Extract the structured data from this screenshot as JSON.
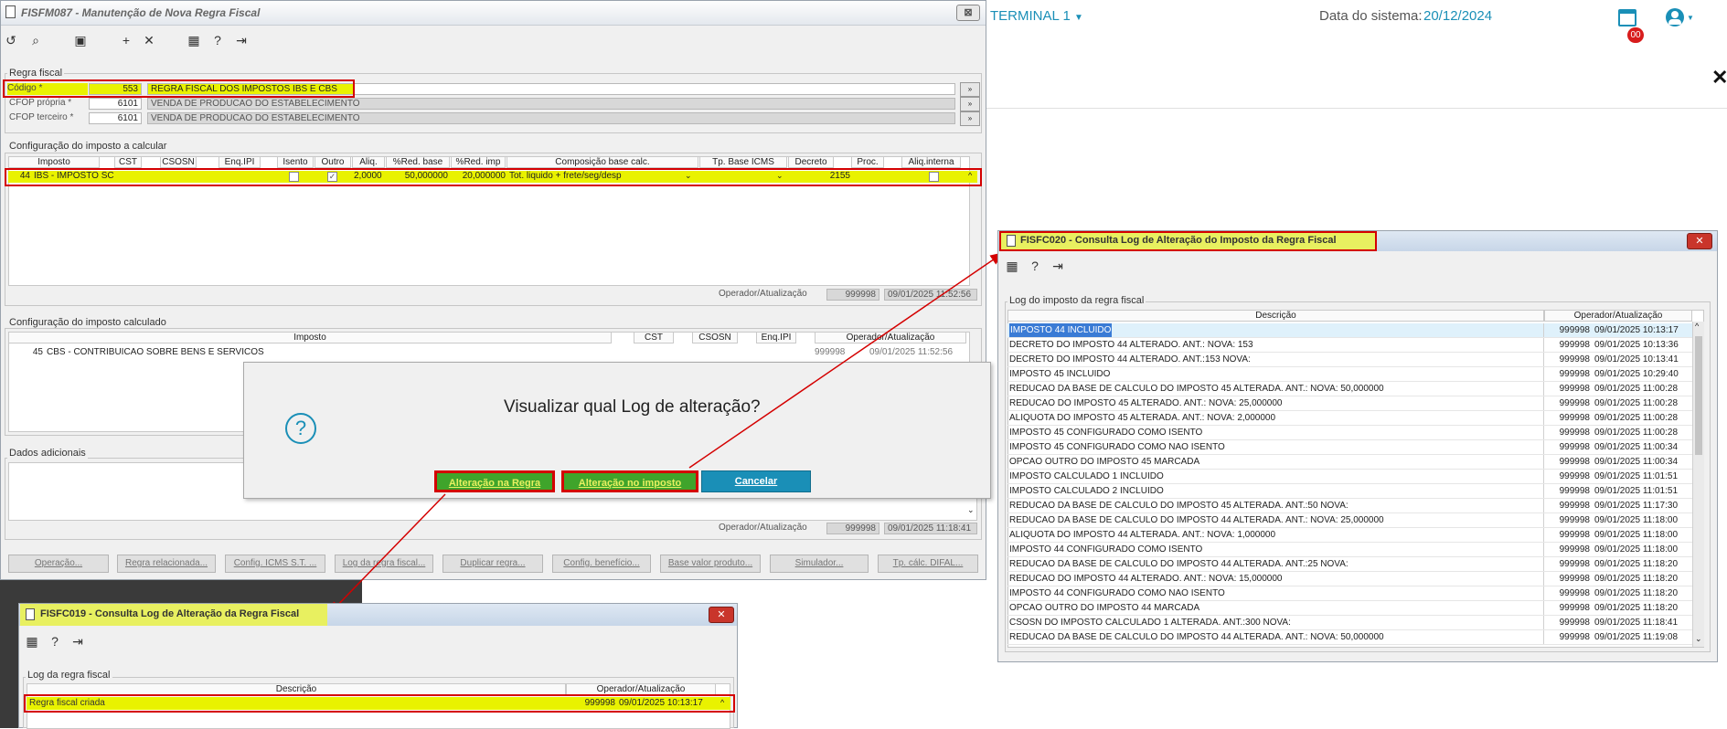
{
  "topbar": {
    "terminal": "TERMINAL 1",
    "date_label": "Data do sistema:",
    "date_value": "20/12/2024",
    "notif_count": "00",
    "close_glyph": "✕"
  },
  "main_window": {
    "title": "FISFM087 - Manutenção de Nova Regra Fiscal",
    "close_glyph": "⊠",
    "regra_fiscal": {
      "group_label": "Regra fiscal",
      "rows": [
        {
          "label": "Código *",
          "code": "553",
          "desc": "REGRA FISCAL DOS IMPOSTOS IBS E CBS"
        },
        {
          "label": "CFOP própria *",
          "code": "6101",
          "desc": "VENDA DE PRODUCAO DO ESTABELECIMENTO"
        },
        {
          "label": "CFOP terceiro *",
          "code": "6101",
          "desc": "VENDA DE PRODUCAO DO ESTABELECIMENTO"
        }
      ]
    },
    "config_calcular": {
      "group_label": "Configuração do imposto a calcular",
      "headers": [
        "Imposto",
        "CST",
        "CSOSN",
        "Enq.IPI",
        "Isento",
        "Outro",
        "Aliq.",
        "%Red. base",
        "%Red. imp",
        "Composição base calc.",
        "Tp. Base ICMS",
        "Decreto",
        "Proc.",
        "Aliq.interna"
      ],
      "row": {
        "code": "44",
        "imposto": "IBS - IMPOSTO SC",
        "aliq": "2,0000",
        "red_base": "50,000000",
        "red_imp": "20,000000",
        "composicao": "Tot. liquido + frete/seg/desp",
        "decreto": "2155"
      },
      "operador_label": "Operador/Atualização",
      "operador": "999998",
      "atualizacao": "09/01/2025 11:52:56"
    },
    "config_calculado": {
      "group_label": "Configuração do imposto calculado",
      "headers": [
        "Imposto",
        "CST",
        "CSOSN",
        "Enq.IPI",
        "Operador/Atualização"
      ],
      "row": {
        "code": "45",
        "imposto": "CBS - CONTRIBUICAO SOBRE BENS E SERVICOS",
        "operador": "999998",
        "atualizacao": "09/01/2025 11:52:56"
      }
    },
    "dados_adicionais": {
      "group_label": "Dados adicionais",
      "operador_label": "Operador/Atualização",
      "operador": "999998",
      "atualizacao": "09/01/2025 11:18:41"
    },
    "bottom_buttons": [
      "Operação...",
      "Regra relacionada...",
      "Config. ICMS S.T. ...",
      "Log da regra fiscal...",
      "Duplicar regra...",
      "Config. benefício...",
      "Base valor produto...",
      "Simulador...",
      "Tp. cálc. DIFAL..."
    ]
  },
  "dialog": {
    "question": "Visualizar qual Log de alteração?",
    "btn_regra": "Alteração na Regra",
    "btn_imposto": "Alteração no imposto",
    "btn_cancel": "Cancelar"
  },
  "win_c020": {
    "title": "FISFC020 - Consulta Log de Alteração do Imposto da Regra Fiscal",
    "group_label": "Log do imposto da regra fiscal",
    "col_desc": "Descrição",
    "col_op": "Operador/Atualização",
    "rows": [
      {
        "d": "IMPOSTO 44 INCLUIDO",
        "o": "999998",
        "t": "09/01/2025 10:13:17"
      },
      {
        "d": "DECRETO DO IMPOSTO 44 ALTERADO. ANT.: NOVA: 153",
        "o": "999998",
        "t": "09/01/2025 10:13:36"
      },
      {
        "d": "DECRETO DO IMPOSTO 44 ALTERADO. ANT.:153 NOVA:",
        "o": "999998",
        "t": "09/01/2025 10:13:41"
      },
      {
        "d": "IMPOSTO 45 INCLUIDO",
        "o": "999998",
        "t": "09/01/2025 10:29:40"
      },
      {
        "d": "REDUCAO DA BASE DE CALCULO DO IMPOSTO 45 ALTERADA. ANT.: NOVA: 50,000000",
        "o": "999998",
        "t": "09/01/2025 11:00:28"
      },
      {
        "d": "REDUCAO DO IMPOSTO 45 ALTERADO. ANT.: NOVA: 25,000000",
        "o": "999998",
        "t": "09/01/2025 11:00:28"
      },
      {
        "d": "ALIQUOTA DO IMPOSTO 45 ALTERADA. ANT.: NOVA: 2,000000",
        "o": "999998",
        "t": "09/01/2025 11:00:28"
      },
      {
        "d": "IMPOSTO 45 CONFIGURADO COMO ISENTO",
        "o": "999998",
        "t": "09/01/2025 11:00:28"
      },
      {
        "d": "IMPOSTO 45 CONFIGURADO COMO NAO ISENTO",
        "o": "999998",
        "t": "09/01/2025 11:00:34"
      },
      {
        "d": "OPCAO OUTRO DO IMPOSTO 45 MARCADA",
        "o": "999998",
        "t": "09/01/2025 11:00:34"
      },
      {
        "d": "IMPOSTO CALCULADO 1 INCLUIDO",
        "o": "999998",
        "t": "09/01/2025 11:01:51"
      },
      {
        "d": "IMPOSTO CALCULADO 2 INCLUIDO",
        "o": "999998",
        "t": "09/01/2025 11:01:51"
      },
      {
        "d": "REDUCAO DA BASE DE CALCULO DO IMPOSTO 45 ALTERADA. ANT.:50 NOVA:",
        "o": "999998",
        "t": "09/01/2025 11:17:30"
      },
      {
        "d": "REDUCAO DA BASE DE CALCULO DO IMPOSTO 44 ALTERADA. ANT.: NOVA: 25,000000",
        "o": "999998",
        "t": "09/01/2025 11:18:00"
      },
      {
        "d": "ALIQUOTA DO IMPOSTO 44 ALTERADA. ANT.: NOVA: 1,000000",
        "o": "999998",
        "t": "09/01/2025 11:18:00"
      },
      {
        "d": "IMPOSTO 44 CONFIGURADO COMO ISENTO",
        "o": "999998",
        "t": "09/01/2025 11:18:00"
      },
      {
        "d": "REDUCAO DA BASE DE CALCULO DO IMPOSTO 44 ALTERADA. ANT.:25 NOVA:",
        "o": "999998",
        "t": "09/01/2025 11:18:20"
      },
      {
        "d": "REDUCAO DO IMPOSTO 44 ALTERADO. ANT.: NOVA: 15,000000",
        "o": "999998",
        "t": "09/01/2025 11:18:20"
      },
      {
        "d": "IMPOSTO 44 CONFIGURADO COMO NAO ISENTO",
        "o": "999998",
        "t": "09/01/2025 11:18:20"
      },
      {
        "d": "OPCAO OUTRO DO IMPOSTO 44 MARCADA",
        "o": "999998",
        "t": "09/01/2025 11:18:20"
      },
      {
        "d": "CSOSN DO IMPOSTO CALCULADO 1 ALTERADA. ANT.:300 NOVA:",
        "o": "999998",
        "t": "09/01/2025 11:18:41"
      },
      {
        "d": "REDUCAO DA BASE DE CALCULO DO IMPOSTO 44 ALTERADA. ANT.: NOVA: 50,000000",
        "o": "999998",
        "t": "09/01/2025 11:19:08"
      }
    ]
  },
  "win_c019": {
    "title": "FISFC019 - Consulta Log de Alteração da Regra Fiscal",
    "group_label": "Log da regra fiscal",
    "col_desc": "Descrição",
    "col_op": "Operador/Atualização",
    "row": {
      "d": "Regra fiscal criada",
      "o": "999998",
      "t": "09/01/2025 10:13:17"
    }
  },
  "colors": {
    "highlight": "#e9f200",
    "annotation_red": "#d40000",
    "accent_blue": "#1a8fb7",
    "title_yellow": "#e8f060"
  }
}
